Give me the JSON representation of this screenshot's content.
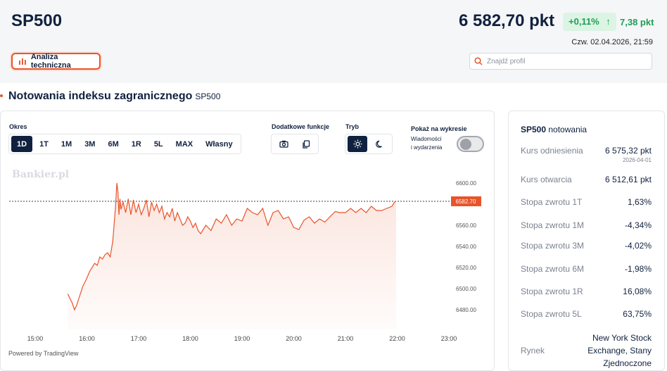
{
  "header": {
    "title": "SP500",
    "price": "6 582,70 pkt",
    "change_pct": "+0,11%",
    "change_abs": "7,38 pkt",
    "datetime": "Czw. 02.04.2026, 21:59",
    "tech_analysis_label": "Analiza techniczna",
    "search_placeholder": "Znajdź profil"
  },
  "section": {
    "title": "Notowania indeksu zagranicznego",
    "subtitle": "SP500"
  },
  "controls": {
    "period_label": "Okres",
    "periods": [
      "1D",
      "1T",
      "1M",
      "3M",
      "6M",
      "1R",
      "5L",
      "MAX",
      "Własny"
    ],
    "active_period": "1D",
    "extra_label": "Dodatkowe funkcje",
    "mode_label": "Tryb",
    "events_title": "Pokaż na wykresie",
    "events_sub1": "Wiadomości",
    "events_sub2": "i wydarzenia"
  },
  "chart": {
    "watermark": "Bankier.pl",
    "powered": "Powered by TradingView",
    "last_price_label": "6582.70",
    "accent": "#e8542a"
  },
  "chart_data": {
    "type": "area",
    "x_ticks": [
      "15:00",
      "16:00",
      "17:00",
      "18:00",
      "19:00",
      "20:00",
      "21:00",
      "22:00",
      "23:00"
    ],
    "y_ticks": [
      "6600.00",
      "6580.00",
      "6560.00",
      "6540.00",
      "6520.00",
      "6500.00",
      "6480.00"
    ],
    "ylim": [
      6472,
      6608
    ],
    "xlim": [
      14.6,
      23.4
    ],
    "last_value": 6582.7,
    "x": [
      15.63,
      15.68,
      15.72,
      15.76,
      15.8,
      15.84,
      15.88,
      15.92,
      15.96,
      16.0,
      16.05,
      16.1,
      16.15,
      16.2,
      16.25,
      16.3,
      16.35,
      16.4,
      16.45,
      16.5,
      16.55,
      16.58,
      16.6,
      16.62,
      16.64,
      16.66,
      16.7,
      16.75,
      16.8,
      16.85,
      16.9,
      16.95,
      17.0,
      17.05,
      17.1,
      17.15,
      17.2,
      17.25,
      17.3,
      17.35,
      17.4,
      17.45,
      17.5,
      17.55,
      17.6,
      17.65,
      17.7,
      17.75,
      17.8,
      17.85,
      17.9,
      17.95,
      18.0,
      18.05,
      18.1,
      18.15,
      18.2,
      18.3,
      18.4,
      18.5,
      18.6,
      18.7,
      18.8,
      18.9,
      19.0,
      19.1,
      19.2,
      19.3,
      19.4,
      19.5,
      19.6,
      19.7,
      19.8,
      19.9,
      20.0,
      20.1,
      20.2,
      20.3,
      20.4,
      20.5,
      20.6,
      20.7,
      20.8,
      20.9,
      21.0,
      21.1,
      21.2,
      21.3,
      21.4,
      21.5,
      21.6,
      21.7,
      21.8,
      21.9,
      21.95,
      21.98
    ],
    "y": [
      6495,
      6490,
      6486,
      6480,
      6484,
      6490,
      6496,
      6502,
      6506,
      6510,
      6516,
      6520,
      6524,
      6522,
      6530,
      6528,
      6532,
      6534,
      6530,
      6545,
      6575,
      6600,
      6592,
      6570,
      6585,
      6575,
      6582,
      6572,
      6585,
      6570,
      6584,
      6572,
      6580,
      6570,
      6576,
      6584,
      6568,
      6582,
      6574,
      6580,
      6572,
      6578,
      6566,
      6572,
      6568,
      6576,
      6564,
      6572,
      6566,
      6560,
      6562,
      6568,
      6564,
      6558,
      6562,
      6555,
      6552,
      6560,
      6555,
      6566,
      6562,
      6570,
      6560,
      6566,
      6564,
      6576,
      6572,
      6570,
      6576,
      6560,
      6572,
      6574,
      6566,
      6568,
      6558,
      6556,
      6565,
      6568,
      6562,
      6566,
      6563,
      6568,
      6573,
      6572,
      6572,
      6576,
      6572,
      6576,
      6572,
      6578,
      6574,
      6574,
      6576,
      6578,
      6582,
      6583
    ]
  },
  "quote": {
    "title_bold": "SP500",
    "title_rest": "notowania",
    "rows": [
      {
        "label": "Kurs odniesienia",
        "value": "6 575,32 pkt",
        "sub": "2026-04-01"
      },
      {
        "label": "Kurs otwarcia",
        "value": "6 512,61 pkt"
      },
      {
        "label": "Stopa zwrotu 1T",
        "value": "1,63%"
      },
      {
        "label": "Stopa zwrotu 1M",
        "value": "-4,34%"
      },
      {
        "label": "Stopa zwrotu 3M",
        "value": "-4,02%"
      },
      {
        "label": "Stopa zwrotu 6M",
        "value": "-1,98%"
      },
      {
        "label": "Stopa zwrotu 1R",
        "value": "16,08%"
      },
      {
        "label": "Stopa zwrotu 5L",
        "value": "63,75%"
      },
      {
        "label": "Rynek",
        "value1": "New York Stock",
        "value2": "Exchange, Stany",
        "value3": "Zjednoczone"
      }
    ]
  }
}
